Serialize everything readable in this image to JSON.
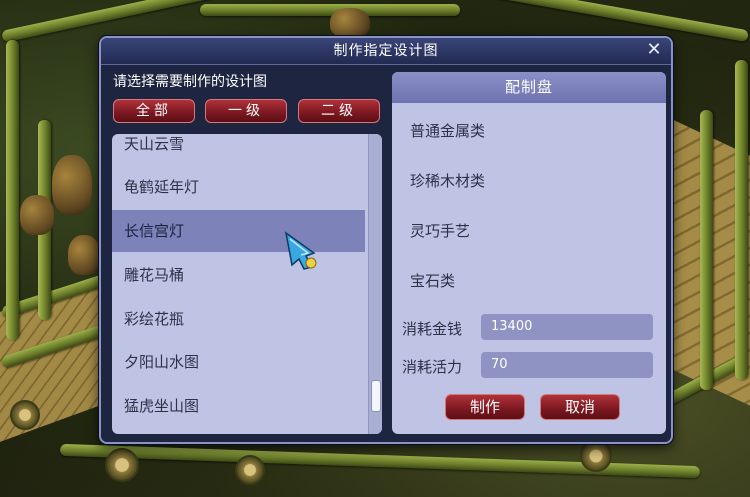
{
  "dialog": {
    "title": "制作指定设计图",
    "close_symbol": "✕",
    "prompt": "请选择需要制作的设计图"
  },
  "tabs": [
    {
      "label": "全部"
    },
    {
      "label": "一级"
    },
    {
      "label": "二级"
    }
  ],
  "design_list": {
    "items": [
      "天山云雪",
      "龟鹤延年灯",
      "长信宫灯",
      "雕花马桶",
      "彩绘花瓶",
      "夕阳山水图",
      "猛虎坐山图"
    ],
    "selected_index": 2,
    "scroll_position": 0.85
  },
  "recipe_panel": {
    "header": "配制盘",
    "slots": [
      "普通金属类",
      "珍稀木材类",
      "灵巧手艺",
      "宝石类"
    ],
    "cost_money_label": "消耗金钱",
    "cost_money_value": "13400",
    "cost_vitality_label": "消耗活力",
    "cost_vitality_value": "70",
    "make_button": "制作",
    "cancel_button": "取消"
  },
  "colors": {
    "panel_bg": "#bfc4e4",
    "selected_row": "#7d82b8",
    "button_red": "#7b1720",
    "dialog_frame": "#1e2540"
  }
}
